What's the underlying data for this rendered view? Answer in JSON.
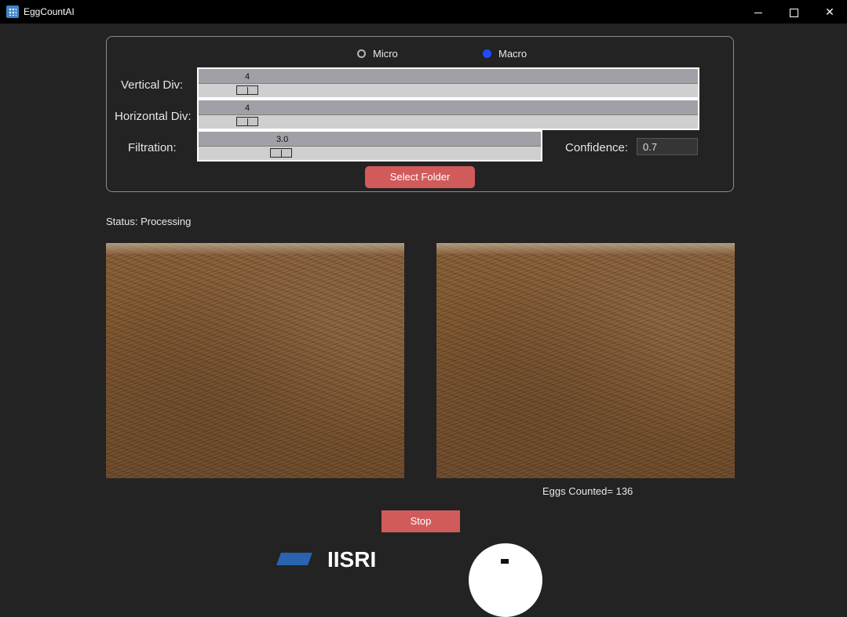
{
  "window": {
    "title": "EggCountAI"
  },
  "mode": {
    "options": [
      "Micro",
      "Macro"
    ],
    "selected": "Macro"
  },
  "sliders": [
    {
      "label": "Vertical Div:",
      "value": "4"
    },
    {
      "label": "Horizontal Div:",
      "value": "4"
    },
    {
      "label": "Filtration:",
      "value": "3.0"
    }
  ],
  "confidence": {
    "label": "Confidence:",
    "value": "0.7"
  },
  "buttons": {
    "select_folder": "Select Folder",
    "stop": "Stop"
  },
  "status": "Status: Processing",
  "eggs_counted": "Eggs Counted= 136",
  "logo_text": "IISRI",
  "colors": {
    "accent_button": "#d15b5b",
    "radio_selected": "#1f4bff",
    "background": "#232323"
  }
}
